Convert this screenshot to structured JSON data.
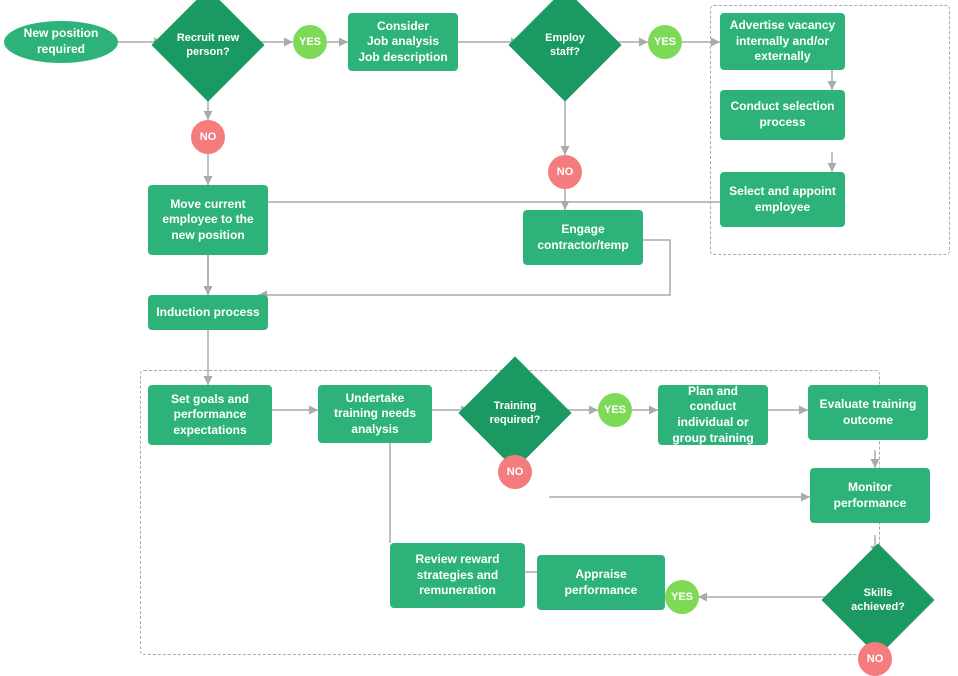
{
  "nodes": {
    "new_position": {
      "label": "New position required"
    },
    "recruit": {
      "label": "Recruit new person?"
    },
    "consider": {
      "label": "Consider\nJob analysis\nJob description"
    },
    "employ": {
      "label": "Employ staff?"
    },
    "advertise": {
      "label": "Advertise vacancy\ninternally and/or\nexternally"
    },
    "conduct_sel": {
      "label": "Conduct selection\nprocess"
    },
    "select_appoint": {
      "label": "Select and appoint\nemployee"
    },
    "move_current": {
      "label": "Move current\nemployee to the\nnew position"
    },
    "engage": {
      "label": "Engage\ncontractor/temp"
    },
    "induction": {
      "label": "Induction process"
    },
    "set_goals": {
      "label": "Set goals and\nperformance\nexpectations"
    },
    "training_needs": {
      "label": "Undertake\ntraining needs\nanalysis"
    },
    "training_req": {
      "label": "Training\nrequired?"
    },
    "plan_conduct": {
      "label": "Plan and conduct\nindividual or\ngroup training"
    },
    "evaluate": {
      "label": "Evaluate training\noutcome"
    },
    "monitor": {
      "label": "Monitor\nperformance"
    },
    "skills": {
      "label": "Skills\nachieved?"
    },
    "appraise": {
      "label": "Appraise\nperformance"
    },
    "review_reward": {
      "label": "Review reward\nstrategies and\nremuneration"
    }
  },
  "badges": {
    "yes1": "YES",
    "yes2": "YES",
    "yes3": "YES",
    "yes4": "YES",
    "no1": "NO",
    "no2": "NO",
    "no3": "NO",
    "no4": "NO"
  }
}
